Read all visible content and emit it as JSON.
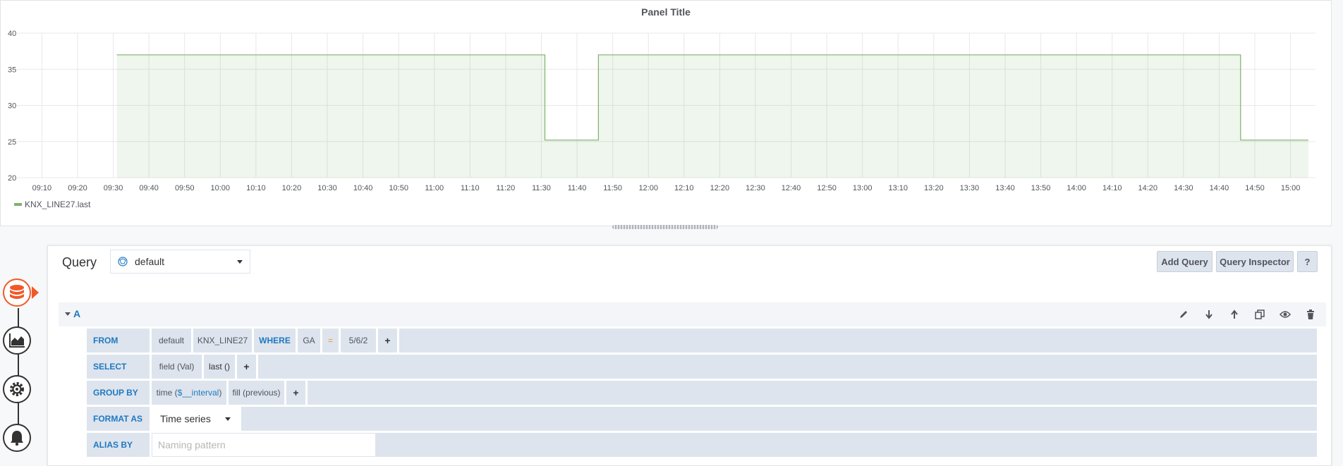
{
  "panel": {
    "title": "Panel Title",
    "legend": "KNX_LINE27.last"
  },
  "chart_data": {
    "type": "line",
    "title": "Panel Title",
    "xlabel": "",
    "ylabel": "",
    "ylim": [
      20,
      40
    ],
    "yticks": [
      "20",
      "25",
      "30",
      "35",
      "40"
    ],
    "xticks": [
      "09:10",
      "09:20",
      "09:30",
      "09:40",
      "09:50",
      "10:00",
      "10:10",
      "10:20",
      "10:30",
      "10:40",
      "10:50",
      "11:00",
      "11:10",
      "11:20",
      "11:30",
      "11:40",
      "11:50",
      "12:00",
      "12:10",
      "12:20",
      "12:30",
      "12:40",
      "12:50",
      "13:00",
      "13:10",
      "13:20",
      "13:30",
      "13:40",
      "13:50",
      "14:00",
      "14:10",
      "14:20",
      "14:30",
      "14:40",
      "14:50",
      "15:00"
    ],
    "x_range": [
      "09:03",
      "15:07"
    ],
    "grid": true,
    "fill": true,
    "color": "#7eb26d",
    "legend_position": "bottom-left",
    "series": [
      {
        "name": "KNX_LINE27.last",
        "points": [
          {
            "x": "09:31",
            "y": 37
          },
          {
            "x": "11:31",
            "y": 37
          },
          {
            "x": "11:31",
            "y": 25.2
          },
          {
            "x": "11:46",
            "y": 25.2
          },
          {
            "x": "11:46",
            "y": 37
          },
          {
            "x": "14:46",
            "y": 37
          },
          {
            "x": "14:46",
            "y": 25.2
          },
          {
            "x": "15:05",
            "y": 25.2
          }
        ]
      }
    ]
  },
  "editor": {
    "query_label": "Query",
    "datasource": "default",
    "add_query": "Add Query",
    "query_inspector": "Query Inspector",
    "help": "?",
    "query_letter": "A",
    "from": {
      "label": "FROM",
      "policy": "default",
      "measurement": "KNX_LINE27",
      "where_label": "WHERE",
      "tag_key": "GA",
      "operator": "=",
      "tag_value": "5/6/2",
      "plus": "+"
    },
    "select": {
      "label": "SELECT",
      "field": "field (Val)",
      "aggregation": "last ()",
      "plus": "+"
    },
    "group_by": {
      "label": "GROUP BY",
      "time_prefix": "time (",
      "time_var": "$__interval",
      "time_suffix": ")",
      "fill": "fill (previous)",
      "plus": "+"
    },
    "format_as": {
      "label": "FORMAT AS",
      "value": "Time series"
    },
    "alias_by": {
      "label": "ALIAS BY",
      "placeholder": "Naming pattern"
    }
  },
  "colors": {
    "series": "#7eb26d",
    "accent_orange": "#f05a28",
    "keyword_blue": "#1f78c1",
    "row_bg": "#dde4ed"
  },
  "icons": [
    "database-icon",
    "graph-icon",
    "gear-icon",
    "bell-icon",
    "pencil-icon",
    "arrow-down-icon",
    "arrow-up-icon",
    "copy-icon",
    "eye-icon",
    "trash-icon"
  ]
}
